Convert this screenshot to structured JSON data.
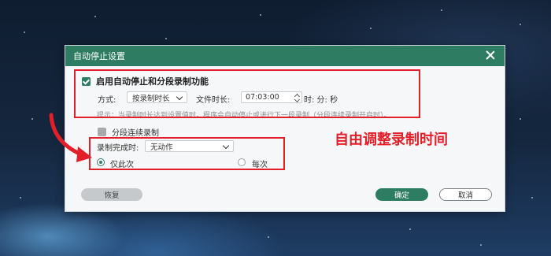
{
  "dialog": {
    "title": "自动停止设置",
    "enable_label": "启用自动停止和分段录制功能",
    "mode_label": "方式:",
    "mode_value": "按录制时长",
    "file_duration_label": "文件时长:",
    "file_duration_value": "07:03:00",
    "time_unit": "时: 分: 秒",
    "hint": "提示：当录制时长达到设置值时，程序会自动停止或进行下一段录制（分段连续录制开启时）。",
    "segment_label": "分段连续录制",
    "complete_label": "录制完成时:",
    "complete_value": "无动作",
    "radio_once": "仅此次",
    "radio_each": "每次",
    "restore_button": "恢复",
    "ok_button": "确定",
    "cancel_button": "取消"
  },
  "annotation": {
    "text": "自由调整录制时间"
  },
  "colors": {
    "accent": "#2e7d62",
    "annotation_red": "#e3202a"
  }
}
